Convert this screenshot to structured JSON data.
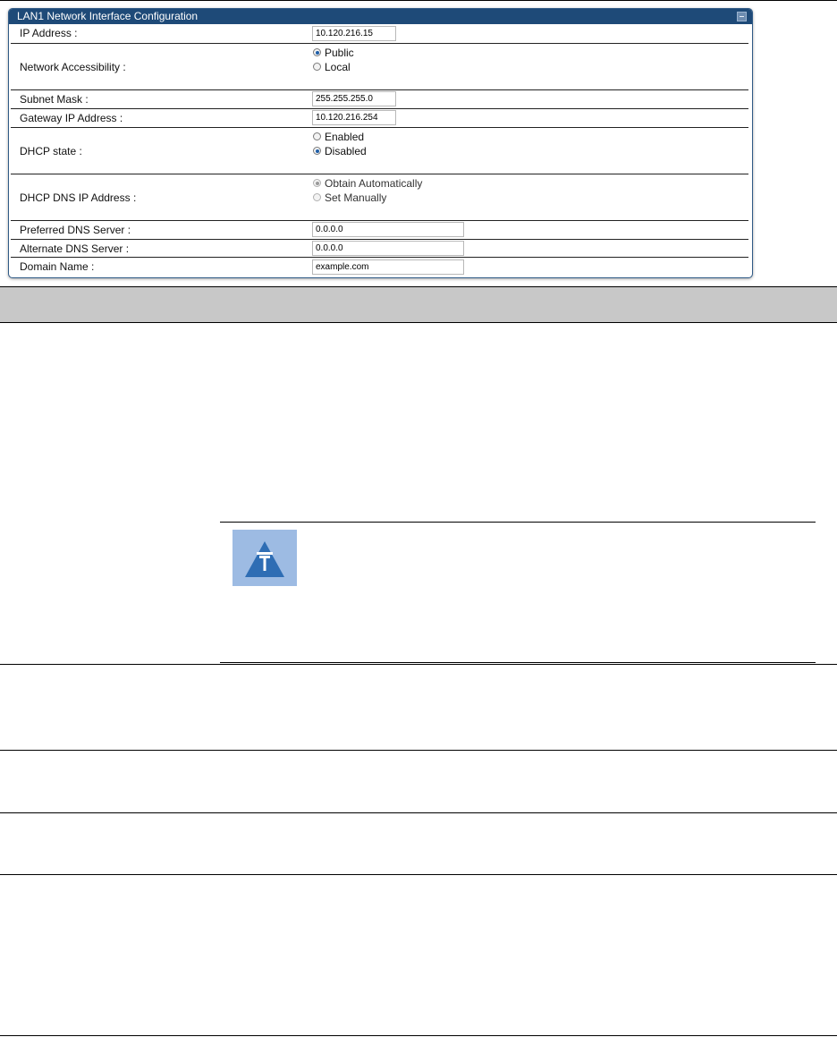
{
  "panel": {
    "title": "LAN1 Network Interface Configuration",
    "fields": {
      "ip_address": {
        "label": "IP Address :",
        "value": "10.120.216.15"
      },
      "network_accessibility": {
        "label": "Network Accessibility :",
        "options": [
          "Public",
          "Local"
        ],
        "selected": "Public"
      },
      "subnet_mask": {
        "label": "Subnet Mask :",
        "value": "255.255.255.0"
      },
      "gateway_ip": {
        "label": "Gateway IP Address :",
        "value": "10.120.216.254"
      },
      "dhcp_state": {
        "label": "DHCP state :",
        "options": [
          "Enabled",
          "Disabled"
        ],
        "selected": "Disabled"
      },
      "dhcp_dns": {
        "label": "DHCP DNS IP Address :",
        "options": [
          "Obtain Automatically",
          "Set Manually"
        ],
        "selected": "Obtain Automatically"
      },
      "preferred_dns": {
        "label": "Preferred DNS Server :",
        "value": "0.0.0.0"
      },
      "alternate_dns": {
        "label": "Alternate DNS Server :",
        "value": "0.0.0.0"
      },
      "domain_name": {
        "label": "Domain Name :",
        "value": "example.com"
      }
    }
  },
  "icons": {
    "collapse": "collapse-icon",
    "note": "note-icon"
  },
  "colors": {
    "panel_header": "#1e4a78",
    "table_header": "#c8c8c8",
    "note_icon_bg": "#9dbbe3"
  }
}
